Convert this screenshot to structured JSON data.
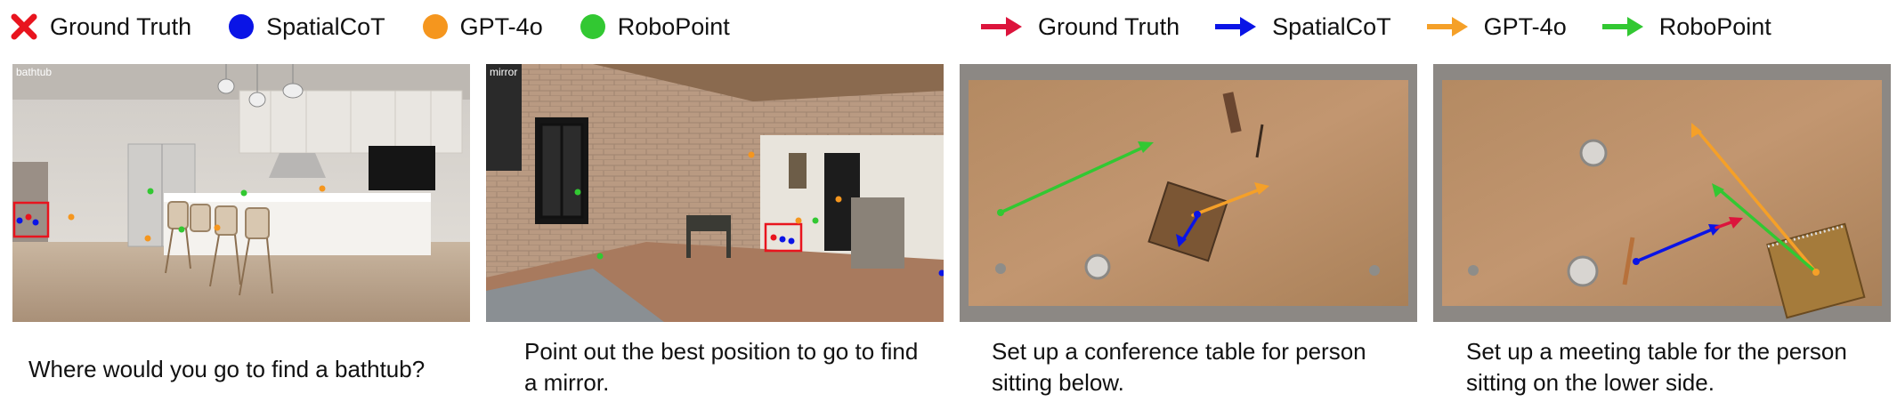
{
  "legend_points": [
    {
      "label": "Ground Truth",
      "color": "#e8141e",
      "icon": "x-cross-icon"
    },
    {
      "label": "SpatialCoT",
      "color": "#0a14e6",
      "icon": "dot-icon"
    },
    {
      "label": "GPT-4o",
      "color": "#f5961e",
      "icon": "dot-icon"
    },
    {
      "label": "RoboPoint",
      "color": "#32c832",
      "icon": "dot-icon"
    }
  ],
  "legend_arrows": [
    {
      "label": "Ground Truth",
      "color": "#dc143c",
      "icon": "arrow-right-icon"
    },
    {
      "label": "SpatialCoT",
      "color": "#0a14e6",
      "icon": "arrow-right-icon"
    },
    {
      "label": "GPT-4o",
      "color": "#f5a028",
      "icon": "arrow-right-icon"
    },
    {
      "label": "RoboPoint",
      "color": "#32c832",
      "icon": "arrow-right-icon"
    }
  ],
  "panels": [
    {
      "tag": "bathtub",
      "caption": "Where would you go to find a bathtub?"
    },
    {
      "tag": "mirror",
      "caption": "Point out the best position to go to find a mirror."
    },
    {
      "tag": "",
      "caption": "Set up a conference table for person sitting below."
    },
    {
      "tag": "",
      "caption": "Set up a meeting table for the person sitting on the lower side."
    }
  ]
}
